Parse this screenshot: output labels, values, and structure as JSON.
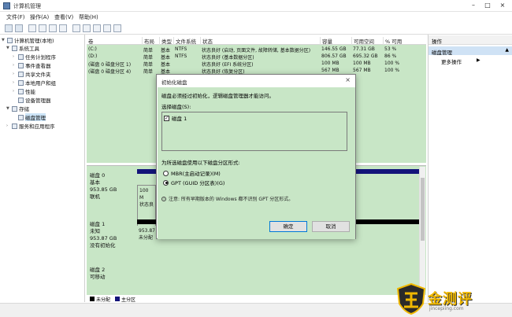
{
  "window": {
    "title": "计算机管理"
  },
  "menu": [
    "文件(F)",
    "操作(A)",
    "查看(V)",
    "帮助(H)"
  ],
  "tree": [
    {
      "label": "计算机管理(本地)",
      "level": 0,
      "expand": "▼"
    },
    {
      "label": "系统工具",
      "level": 1,
      "expand": "▼"
    },
    {
      "label": "任务计划程序",
      "level": 2,
      "expand": "›"
    },
    {
      "label": "事件查看器",
      "level": 2,
      "expand": "›"
    },
    {
      "label": "共享文件夹",
      "level": 2,
      "expand": "›"
    },
    {
      "label": "本地用户和组",
      "level": 2,
      "expand": "›"
    },
    {
      "label": "性能",
      "level": 2,
      "expand": "›"
    },
    {
      "label": "设备管理器",
      "level": 2,
      "expand": ""
    },
    {
      "label": "存储",
      "level": 1,
      "expand": "▼"
    },
    {
      "label": "磁盘管理",
      "level": 2,
      "expand": "",
      "selected": true
    },
    {
      "label": "服务和应用程序",
      "level": 1,
      "expand": "›"
    }
  ],
  "columns": [
    "卷",
    "布局",
    "类型",
    "文件系统",
    "状态",
    "容量",
    "可用空间",
    "% 可用"
  ],
  "volumes": [
    {
      "vol": "(C:)",
      "layout": "简单",
      "type": "基本",
      "fs": "NTFS",
      "status": "状态良好 (启动, 页面文件, 故障转储, 基本数据分区)",
      "capacity": "146.55 GB",
      "free": "77.31 GB",
      "pct": "53 %"
    },
    {
      "vol": "(D:)",
      "layout": "简单",
      "type": "基本",
      "fs": "NTFS",
      "status": "状态良好 (基本数据分区)",
      "capacity": "806.57 GB",
      "free": "695.32 GB",
      "pct": "86 %"
    },
    {
      "vol": "(磁盘 0 磁盘分区 1)",
      "layout": "简单",
      "type": "基本",
      "fs": "",
      "status": "状态良好 (EFI 系统分区)",
      "capacity": "100 MB",
      "free": "100 MB",
      "pct": "100 %"
    },
    {
      "vol": "(磁盘 0 磁盘分区 4)",
      "layout": "简单",
      "type": "基本",
      "fs": "",
      "status": "状态良好 (恢复分区)",
      "capacity": "567 MB",
      "free": "567 MB",
      "pct": "100 %"
    }
  ],
  "disks": [
    {
      "name": "磁盘 0",
      "type": "基本",
      "size": "953.85 GB",
      "state": "联机",
      "part_size": "100 M",
      "part_state": "状态良"
    },
    {
      "name": "磁盘 1",
      "type": "未知",
      "size": "953.87 GB",
      "state": "没有初始化",
      "part_size": "953.87 GB",
      "part_state": "未分配"
    },
    {
      "name": "磁盘 2",
      "type": "可移动",
      "size": "",
      "state": "",
      "part_size": "",
      "part_state": ""
    }
  ],
  "legend": [
    {
      "label": "未分配",
      "color": "#000000"
    },
    {
      "label": "主分区",
      "color": "#14147a"
    }
  ],
  "actions": {
    "header": "操作",
    "section": "磁盘管理",
    "more": "更多操作"
  },
  "dialog": {
    "title": "初始化磁盘",
    "intro": "磁盘必须经过初始化，逻辑磁盘管理器才能访问。",
    "select_label": "选择磁盘(S):",
    "disk_item": "磁盘 1",
    "style_label": "为所选磁盘使用以下磁盘分区形式:",
    "options": [
      "MBR(主启动记录)(M)",
      "GPT (GUID 分区表)(G)"
    ],
    "selected_option": 1,
    "note": "注意: 所有早期版本的 Windows 都不识别 GPT 分区形式。",
    "ok": "确定",
    "cancel": "取消"
  },
  "watermark": {
    "text": "金测评",
    "url": "jincepiing.com"
  }
}
